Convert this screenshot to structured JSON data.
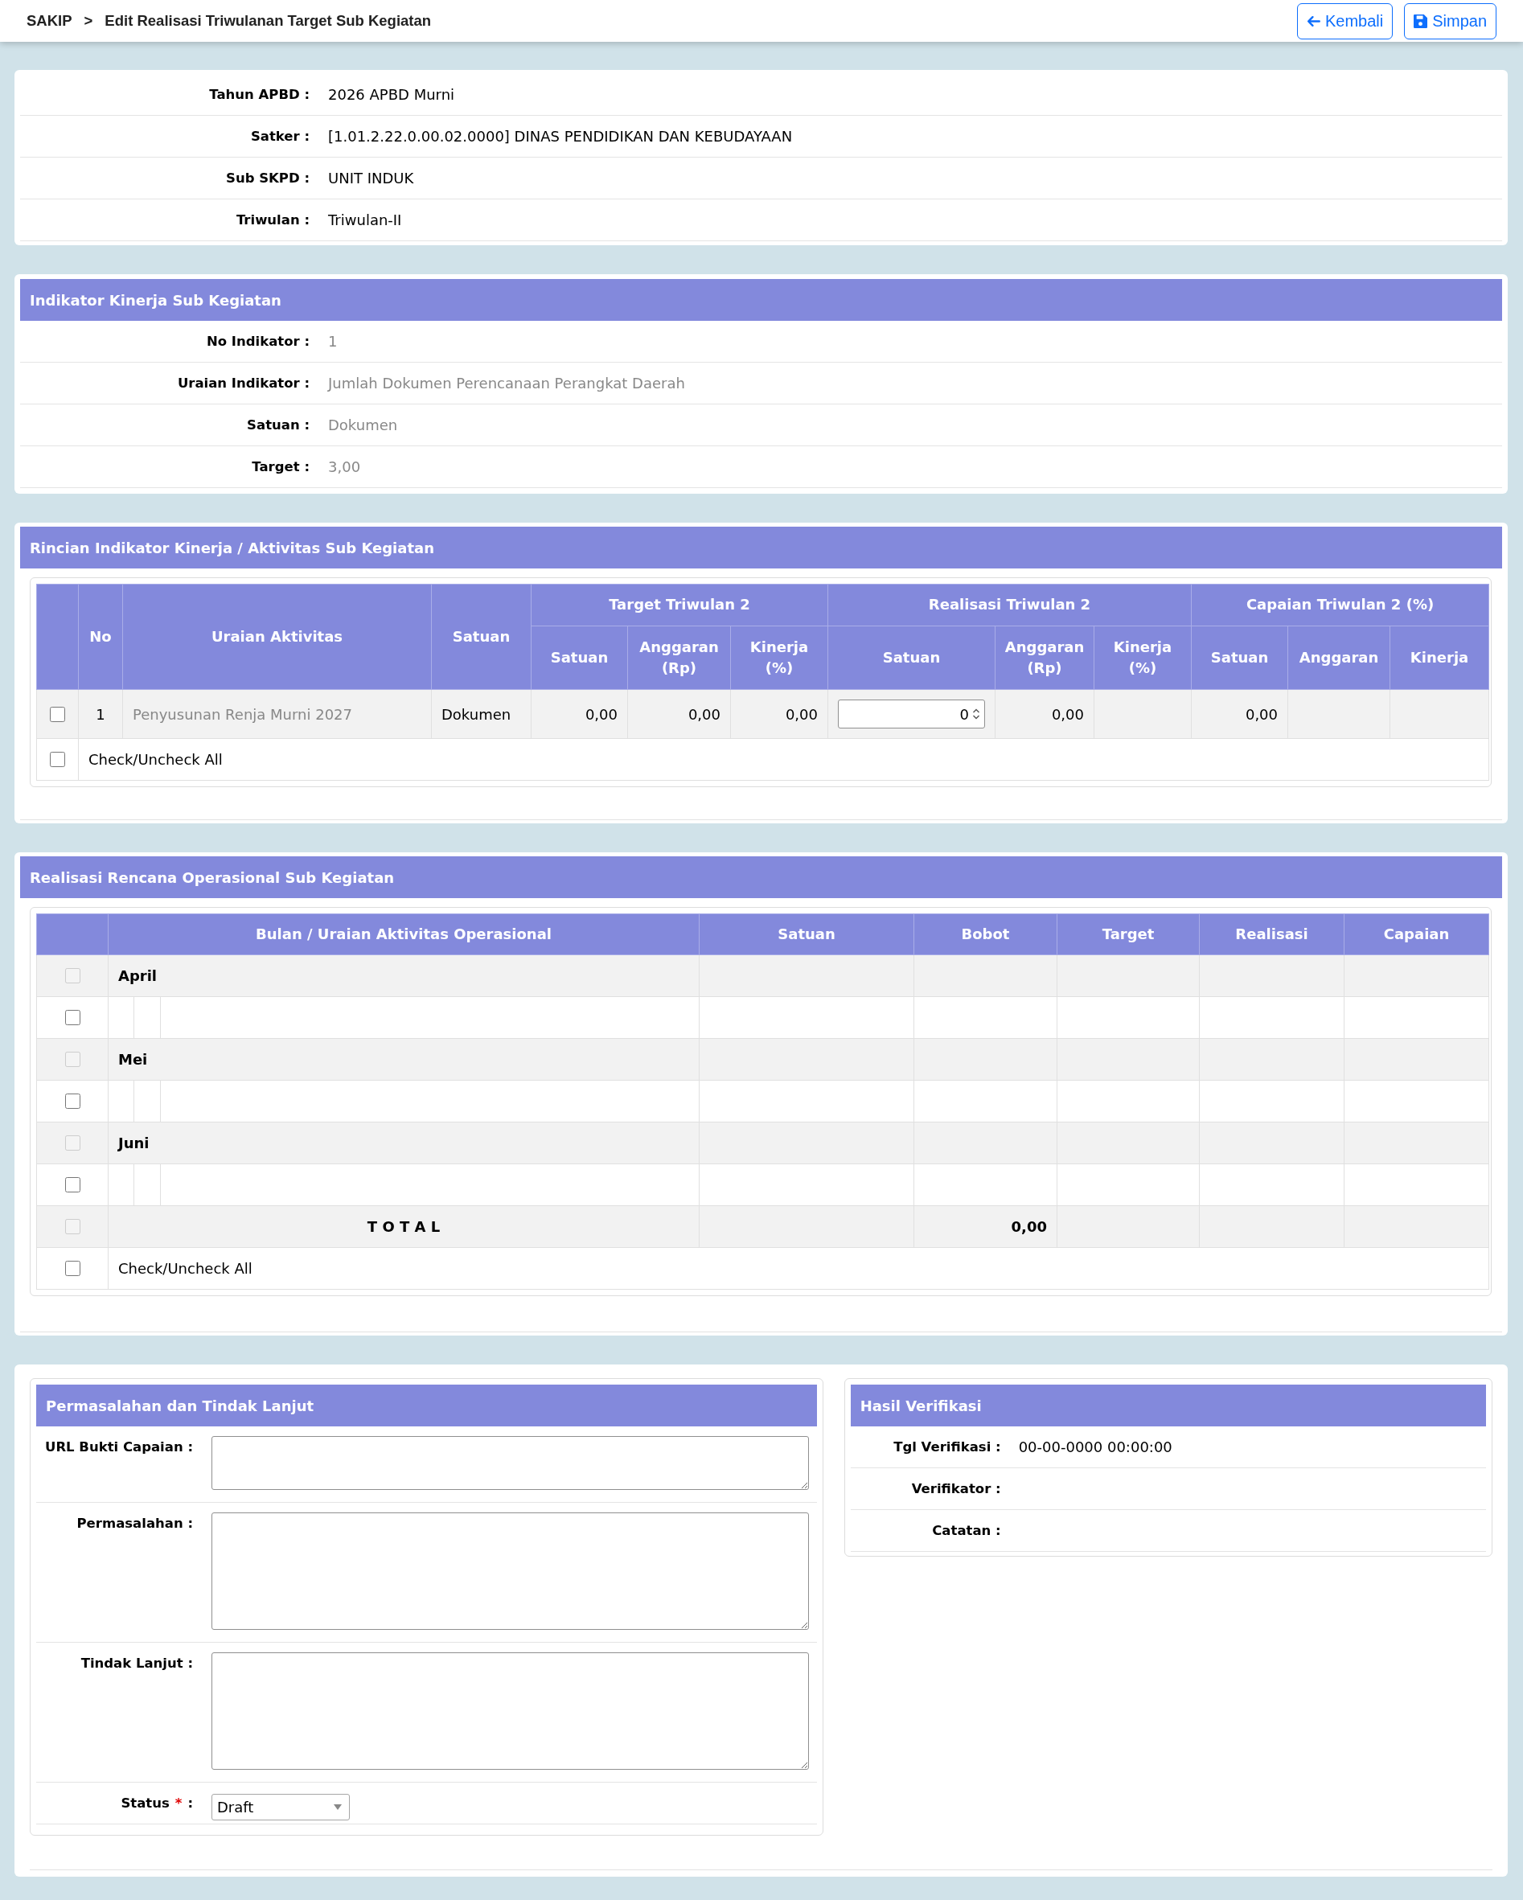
{
  "header": {
    "breadcrumb": "SAKIP",
    "separator": ">",
    "title": "Edit Realisasi Triwulanan Target Sub Kegiatan",
    "buttons": [
      {
        "kind": "back",
        "label": "Kembali"
      },
      {
        "kind": "save",
        "label": "Simpan"
      }
    ]
  },
  "info": {
    "rows": [
      {
        "label": "Tahun APBD :",
        "value": "2026 APBD Murni"
      },
      {
        "label": "Satker :",
        "value": "[1.01.2.22.0.00.02.0000] DINAS PENDIDIKAN DAN KEBUDAYAAN"
      },
      {
        "label": "Sub SKPD :",
        "value": "UNIT INDUK"
      },
      {
        "label": "Triwulan :",
        "value": "Triwulan-II"
      }
    ]
  },
  "indikator": {
    "title": "Indikator Kinerja Sub Kegiatan",
    "rows": [
      {
        "label": "No Indikator :",
        "value": "1"
      },
      {
        "label": "Uraian Indikator :",
        "value": "Jumlah Dokumen Perencanaan Perangkat Daerah"
      },
      {
        "label": "Satuan :",
        "value": "Dokumen"
      },
      {
        "label": "Target :",
        "value": "3,00"
      }
    ]
  },
  "rincian": {
    "title": "Rincian Indikator Kinerja / Aktivitas Sub Kegiatan",
    "columns": [
      {
        "kind": "checkbox"
      },
      {
        "kind": "text",
        "label": "No"
      },
      {
        "kind": "text",
        "label": "Uraian Aktivitas"
      },
      {
        "kind": "text",
        "label": "Satuan"
      },
      {
        "kind": "group",
        "label": "Target Triwulan 2",
        "colspan": 3,
        "children": [
          {
            "label": "Satuan"
          },
          {
            "label": "Anggaran (Rp)"
          },
          {
            "label": "Kinerja (%)"
          }
        ]
      },
      {
        "kind": "group",
        "label": "Realisasi Triwulan 2",
        "colspan": 3,
        "children": [
          {
            "label": "Satuan"
          },
          {
            "label": "Anggaran (Rp)"
          },
          {
            "label": "Kinerja (%)"
          }
        ]
      },
      {
        "kind": "group",
        "label": "Capaian Triwulan 2 (%)",
        "colspan": 3,
        "children": [
          {
            "label": "Satuan"
          },
          {
            "label": "Anggaran"
          },
          {
            "label": "Kinerja"
          }
        ]
      }
    ],
    "rows": [
      {
        "cells": [
          {
            "kind": "checkbox",
            "checked": false
          },
          {
            "value": "1"
          },
          {
            "value": "Penyusunan Renja Murni 2027"
          },
          {
            "value": "Dokumen"
          },
          {
            "value": "0,00"
          },
          {
            "value": "0,00"
          },
          {
            "value": "0,00"
          },
          {
            "kind": "number_input",
            "value": "0"
          },
          {
            "value": "0,00"
          },
          null,
          {
            "value": "0,00"
          },
          null,
          null
        ]
      }
    ],
    "footer": {
      "checked": false,
      "label": "Check/Uncheck All"
    }
  },
  "operasional": {
    "title": "Realisasi Rencana Operasional Sub Kegiatan",
    "columns": [
      {
        "kind": "checkbox"
      },
      {
        "kind": "text",
        "label": "Bulan / Uraian Aktivitas Operasional",
        "colspan": 3
      },
      {
        "kind": "text",
        "label": "Satuan"
      },
      {
        "kind": "text",
        "label": "Bobot"
      },
      {
        "kind": "text",
        "label": "Target"
      },
      {
        "kind": "text",
        "label": "Realisasi"
      },
      {
        "kind": "text",
        "label": "Capaian"
      }
    ],
    "rows": [
      {
        "kind": "month",
        "label": "April",
        "checked": false,
        "disabled": true
      },
      {
        "kind": "item",
        "checked": false,
        "disabled": false
      },
      {
        "kind": "month",
        "label": "Mei",
        "checked": false,
        "disabled": true
      },
      {
        "kind": "item",
        "checked": false,
        "disabled": false
      },
      {
        "kind": "month",
        "label": "Juni",
        "checked": false,
        "disabled": true
      },
      {
        "kind": "item",
        "checked": false,
        "disabled": false
      },
      {
        "kind": "total",
        "label": "T O T A L",
        "checked": false,
        "disabled": true,
        "cells": [
          null,
          {
            "value": "0,00"
          },
          null,
          null,
          null
        ]
      }
    ],
    "footer": {
      "checked": false,
      "label": "Check/Uncheck All"
    }
  },
  "followup": {
    "title": "Permasalahan dan Tindak Lanjut",
    "fields": [
      {
        "kind": "short_text",
        "label": "URL Bukti Capaian :"
      },
      {
        "kind": "long_text",
        "label": "Permasalahan :"
      },
      {
        "kind": "long_text",
        "label": "Tindak Lanjut :"
      },
      {
        "kind": "select",
        "label": "Status",
        "required_mark": "*",
        "suffix": ":",
        "value": "Draft"
      }
    ]
  },
  "verifikasi": {
    "title": "Hasil Verifikasi",
    "rows": [
      {
        "label": "Tgl Verifikasi :",
        "value": "00-00-0000 00:00:00"
      },
      {
        "label": "Verifikator :"
      },
      {
        "label": "Catatan :"
      }
    ]
  }
}
